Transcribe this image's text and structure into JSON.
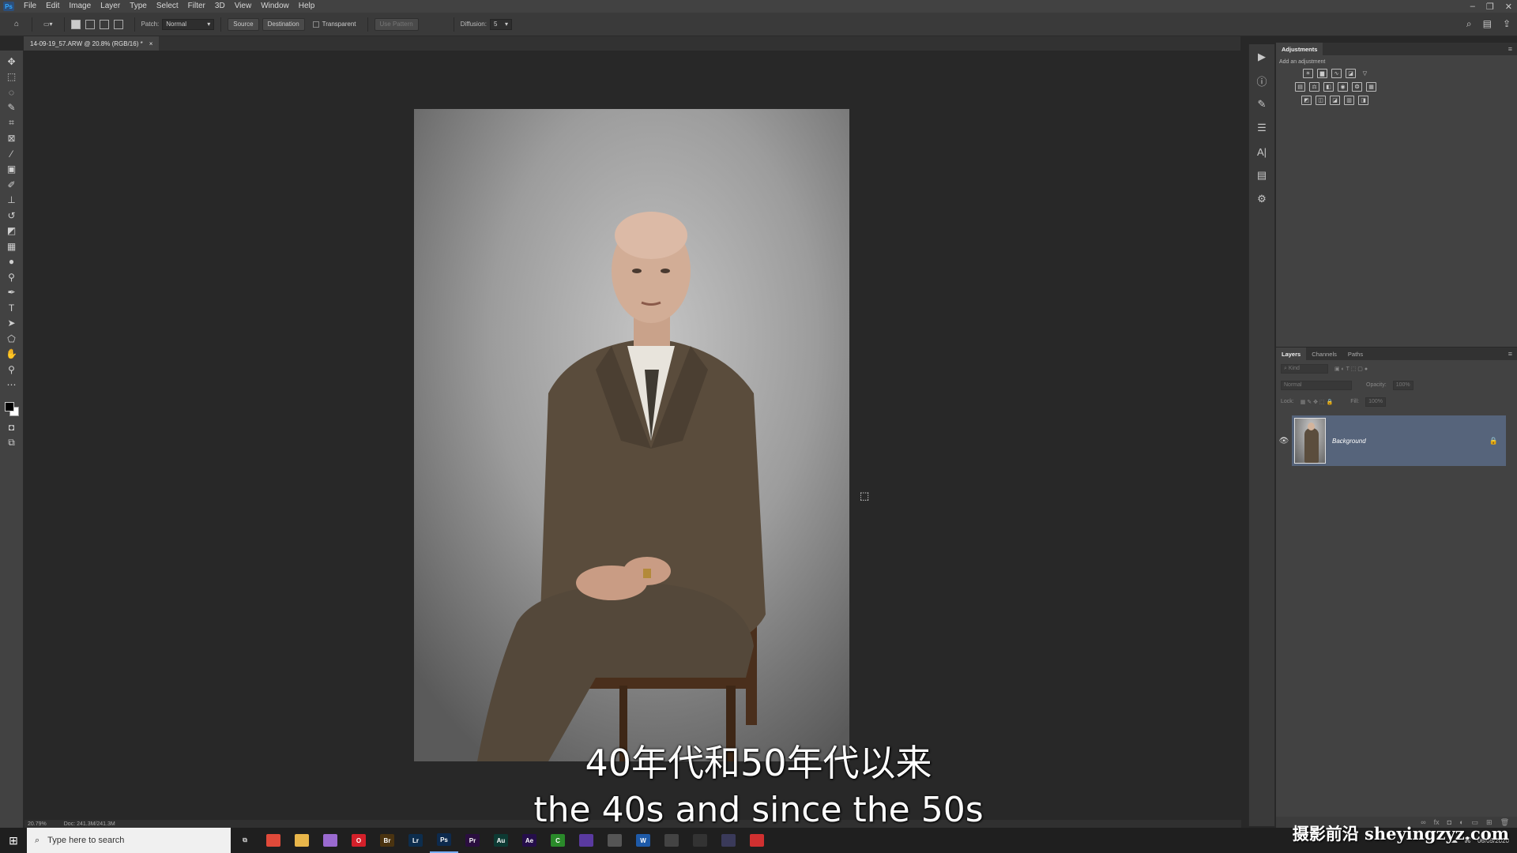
{
  "menubar": {
    "items": [
      "File",
      "Edit",
      "Image",
      "Layer",
      "Type",
      "Select",
      "Filter",
      "3D",
      "View",
      "Window",
      "Help"
    ]
  },
  "options": {
    "patch_label": "Patch:",
    "patch_mode": "Normal",
    "source": "Source",
    "destination": "Destination",
    "transparent": "Transparent",
    "use_pattern": "Use Pattern",
    "diffusion_label": "Diffusion:",
    "diffusion_value": "5"
  },
  "document": {
    "tab_title": "14-09-19_57.ARW @ 20.8% (RGB/16) *",
    "zoom": "20.79%",
    "doc_info": "Doc: 241.3M/241.3M"
  },
  "adjustments": {
    "title": "Adjustments",
    "subtitle": "Add an adjustment"
  },
  "layers_panel": {
    "tabs": [
      "Layers",
      "Channels",
      "Paths"
    ],
    "kind_placeholder": "Kind",
    "blend_mode": "Normal",
    "opacity_label": "Opacity:",
    "opacity_value": "100%",
    "lock_label": "Lock:",
    "fill_label": "Fill:",
    "fill_value": "100%",
    "layer_name": "Background"
  },
  "taskbar": {
    "search_placeholder": "Type here to search",
    "apps": [
      {
        "icon": "chrome-icon",
        "label": "",
        "color": "#e04a3a"
      },
      {
        "icon": "file-explorer-icon",
        "label": "",
        "color": "#e8b64a"
      },
      {
        "icon": "app-icon",
        "label": "",
        "color": "#9a6ad0"
      },
      {
        "icon": "opera-icon",
        "label": "O",
        "color": "#d4202a"
      },
      {
        "icon": "bridge-icon",
        "label": "Br",
        "color": "#4a3310"
      },
      {
        "icon": "lightroom-icon",
        "label": "Lr",
        "color": "#0d2d4d"
      },
      {
        "icon": "photoshop-icon",
        "label": "Ps",
        "color": "#0d2a4d"
      },
      {
        "icon": "premiere-icon",
        "label": "Pr",
        "color": "#2a0e3f"
      },
      {
        "icon": "audition-icon",
        "label": "Au",
        "color": "#0d3a33"
      },
      {
        "icon": "after-effects-icon",
        "label": "Ae",
        "color": "#250e4a"
      },
      {
        "icon": "camtasia-icon",
        "label": "C",
        "color": "#2a8a2a"
      },
      {
        "icon": "app-icon",
        "label": "",
        "color": "#5a3aa0"
      },
      {
        "icon": "app-icon",
        "label": "",
        "color": "#555"
      },
      {
        "icon": "word-icon",
        "label": "W",
        "color": "#1e5aa8"
      },
      {
        "icon": "app-icon",
        "label": "",
        "color": "#444"
      },
      {
        "icon": "app-icon",
        "label": "",
        "color": "#333"
      },
      {
        "icon": "app-icon",
        "label": "",
        "color": "#3a3a5a"
      },
      {
        "icon": "recorder-icon",
        "label": "",
        "color": "#d03030"
      }
    ],
    "date": "06/05/2020"
  },
  "subtitles": {
    "chinese": "40年代和50年代以来",
    "english": "the 40s and since the 50s"
  },
  "watermark": "摄影前沿 sheyingzyz.com"
}
